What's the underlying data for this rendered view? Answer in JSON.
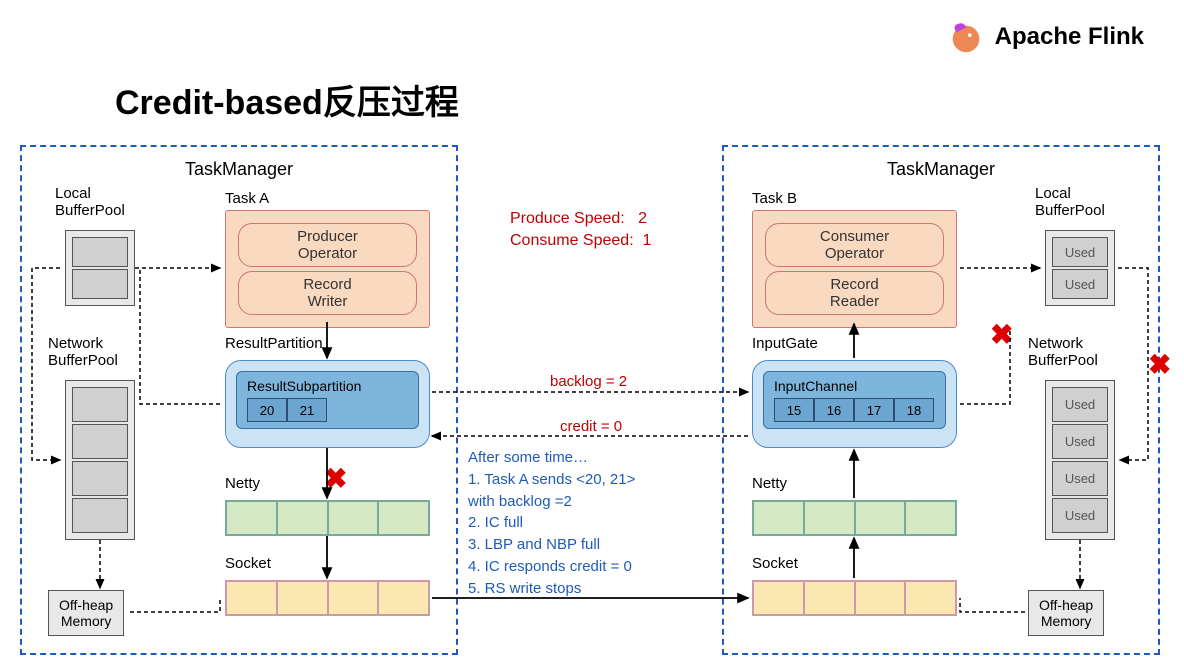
{
  "brand": {
    "name": "Apache Flink"
  },
  "title": "Credit-based反压过程",
  "left_tm": {
    "label": "TaskManager",
    "local_bp": "Local\nBufferPool",
    "network_bp": "Network\nBufferPool",
    "task_label": "Task A",
    "producer": "Producer\nOperator",
    "writer": "Record\nWriter",
    "result_partition": "ResultPartition",
    "subpartition": "ResultSubpartition",
    "buf": [
      "20",
      "21"
    ],
    "netty": "Netty",
    "socket": "Socket",
    "offheap": "Off-heap\nMemory"
  },
  "right_tm": {
    "label": "TaskManager",
    "local_bp": "Local\nBufferPool",
    "network_bp": "Network\nBufferPool",
    "task_label": "Task B",
    "consumer": "Consumer\nOperator",
    "reader": "Record\nReader",
    "input_gate": "InputGate",
    "input_channel": "InputChannel",
    "buf": [
      "15",
      "16",
      "17",
      "18"
    ],
    "netty": "Netty",
    "socket": "Socket",
    "offheap": "Off-heap\nMemory",
    "used": "Used"
  },
  "speeds": {
    "produce": "Produce Speed:",
    "produce_val": "2",
    "consume": "Consume Speed:",
    "consume_val": "1"
  },
  "messages": {
    "backlog": "backlog = 2",
    "credit": "credit = 0"
  },
  "notes": {
    "head": "After some time…",
    "l1": "1.    Task A sends <20, 21>",
    "l1b": "with backlog =2",
    "l2": "2.    IC full",
    "l3": "3.    LBP and NBP full",
    "l4": "4.    IC responds credit = 0",
    "l5": "5.    RS write stops"
  }
}
